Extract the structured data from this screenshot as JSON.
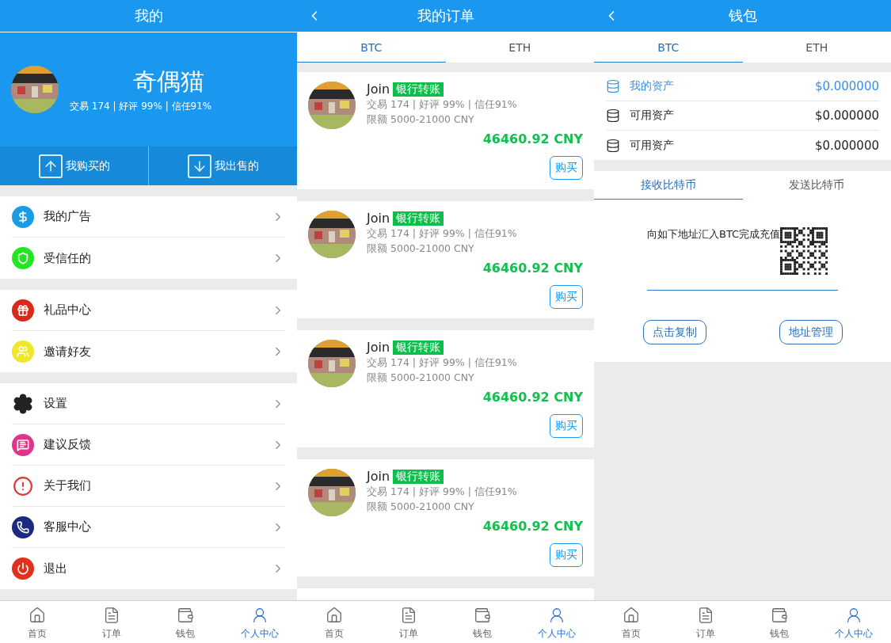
{
  "screens": [
    {
      "kind": "profile",
      "title": "我的",
      "back": false,
      "user": {
        "name": "奇偶猫",
        "stats": "交易 174 | 好评 99% | 信任91%"
      },
      "actions": [
        {
          "label": "我购买的"
        },
        {
          "label": "我出售的"
        }
      ],
      "menu_groups": [
        {
          "items": [
            {
              "label": "我的广告",
              "color": "#1a9be6"
            },
            {
              "label": "受信任的",
              "color": "#22e622"
            }
          ]
        },
        {
          "items": [
            {
              "label": "礼品中心",
              "color": "#d62b1a"
            },
            {
              "label": "邀请好友",
              "color": "#f0e62a"
            }
          ]
        },
        {
          "items": [
            {
              "label": "设置",
              "color": "#222222"
            },
            {
              "label": "建议反馈",
              "color": "#e0358a"
            },
            {
              "label": "关于我们",
              "color": "#e03a3a"
            },
            {
              "label": "客服中心",
              "color": "#1a2a80"
            },
            {
              "label": "退出",
              "color": "#e0301e"
            }
          ]
        }
      ],
      "nav": [
        {
          "label": "首页",
          "selected": false
        },
        {
          "label": "订单",
          "selected": false
        },
        {
          "label": "钱包",
          "selected": false
        },
        {
          "label": "个人中心",
          "selected": true
        }
      ]
    },
    {
      "kind": "orders",
      "title": "我的订单",
      "back": true,
      "tabs": [
        {
          "label": "BTC",
          "selected": true
        },
        {
          "label": "ETH",
          "selected": false
        }
      ],
      "cards": [
        {
          "name": "Join",
          "tag": "银行转账",
          "stats": "交易 174 | 好评 99% | 信任91%",
          "limit": "限额 5000-21000 CNY",
          "price": "46460.92 CNY",
          "button": "购买"
        },
        {
          "name": "Join",
          "tag": "银行转账",
          "stats": "交易 174 | 好评 99% | 信任91%",
          "limit": "限额 5000-21000 CNY",
          "price": "46460.92 CNY",
          "button": "购买"
        },
        {
          "name": "Join",
          "tag": "银行转账",
          "stats": "交易 174 | 好评 99% | 信任91%",
          "limit": "限额 5000-21000 CNY",
          "price": "46460.92 CNY",
          "button": "购买"
        },
        {
          "name": "Join",
          "tag": "银行转账",
          "stats": "交易 174 | 好评 99% | 信任91%",
          "limit": "限额 5000-21000 CNY",
          "price": "46460.92 CNY",
          "button": "购买"
        }
      ],
      "nav": [
        {
          "label": "首页",
          "selected": false
        },
        {
          "label": "订单",
          "selected": false
        },
        {
          "label": "钱包",
          "selected": false
        },
        {
          "label": "个人中心",
          "selected": true
        }
      ]
    },
    {
      "kind": "wallet",
      "title": "钱包",
      "back": true,
      "tabs": [
        {
          "label": "BTC",
          "selected": true
        },
        {
          "label": "ETH",
          "selected": false
        }
      ],
      "assets": [
        {
          "label": "我的资产",
          "value": "$0.000000",
          "selected": true
        },
        {
          "label": "可用资产",
          "value": "$0.000000",
          "selected": false
        },
        {
          "label": "可用资产",
          "value": "$0.000000",
          "selected": false
        }
      ],
      "sub_tabs": [
        {
          "label": "接收比特币",
          "selected": true
        },
        {
          "label": "发送比特币",
          "selected": false
        }
      ],
      "instruction": "向如下地址汇入BTC完成充值",
      "buttons": [
        {
          "label": "点击复制"
        },
        {
          "label": "地址管理"
        }
      ],
      "nav": [
        {
          "label": "首页",
          "selected": false
        },
        {
          "label": "订单",
          "selected": false
        },
        {
          "label": "钱包",
          "selected": false
        },
        {
          "label": "个人中心",
          "selected": true
        }
      ]
    }
  ]
}
